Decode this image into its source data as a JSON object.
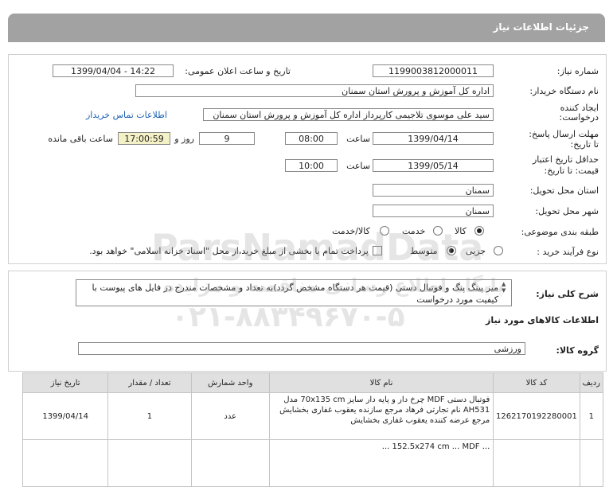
{
  "header": {
    "title": "جزئیات اطلاعات نیاز"
  },
  "form": {
    "need_number_label": "شماره نیاز:",
    "need_number": "1199003812000011",
    "announce_label": "تاریخ و ساعت اعلان عمومی:",
    "announce_value": "1399/04/04 - 14:22",
    "buyer_label": "نام دستگاه خریدار:",
    "buyer_value": "اداره کل آموزش و پرورش استان سمنان",
    "creator_label_1": "ایجاد کننده",
    "creator_label_2": "درخواست:",
    "creator_value": "سید علی موسوی تلاجیمی کارپرداز اداره کل آموزش و پرورش استان سمنان",
    "contact_link": "اطلاعات تماس خریدار",
    "deadline_label_1": "مهلت ارسال پاسخ:",
    "deadline_label_2": "تا تاریخ:",
    "deadline_date": "1399/04/14",
    "time_label": "ساعت",
    "deadline_time": "08:00",
    "days_value": "9",
    "days_label": "روز و",
    "remaining_time": "17:00:59",
    "remaining_label": "ساعت باقی مانده",
    "validity_label_1": "حداقل تاریخ اعتبار",
    "validity_label_2": "قیمت: تا تاریخ:",
    "validity_date": "1399/05/14",
    "validity_time": "10:00",
    "province_label": "استان محل تحویل:",
    "province_value": "سمنان",
    "city_label": "شهر محل تحویل:",
    "city_value": "سمنان",
    "category_label": "طبقه بندی موضوعی:",
    "category_options": [
      "کالا",
      "خدمت",
      "کالا/خدمت"
    ],
    "process_label": "نوع فرآیند خرید :",
    "process_options": [
      "جزیی",
      "متوسط"
    ],
    "payment_note": "پرداخت تمام یا بخشی از مبلغ خرید،از محل \"اسناد خزانه اسلامی\" خواهد بود.",
    "description_label": "شرح کلی نیاز:",
    "description": "میز پینگ پنگ و فوتبال دستی (قیمت هر دستگاه مشخص گردد)به تعداد و مشخصات مندرج در فایل های پیوست با کیفیت مورد درخواست",
    "goods_info_title": "اطلاعات کالاهای مورد نیاز",
    "goods_group_label": "گروه کالا:",
    "goods_group_value": "ورزشی"
  },
  "watermark": {
    "brand": "ParsNamadData",
    "line1": "پایگاه اطلاع رسانی مناقصه و مزایده",
    "phone": "۰۲۱-۸۸۳۴۹۶۷۰-۵"
  },
  "table": {
    "headers": [
      "ردیف",
      "کد کالا",
      "نام کالا",
      "واحد شمارش",
      "تعداد / مقدار",
      "تاریخ نیاز"
    ],
    "rows": [
      {
        "index": "1",
        "code": "1262170192280001",
        "name": "فوتبال دستی MDF چرخ دار و پایه دار سایز 70x135 cm مدل AH531 نام تجارتی فرهاد مرجع سازنده یعقوب غفاری بخشایش مرجع عرضه کننده یعقوب غفاری بخشایش",
        "unit": "عدد",
        "qty": "1",
        "date": "1399/04/14"
      },
      {
        "index": "",
        "code": "",
        "name": "... 152.5x274 cm ... MDF ...",
        "unit": "",
        "qty": "",
        "date": ""
      }
    ]
  }
}
